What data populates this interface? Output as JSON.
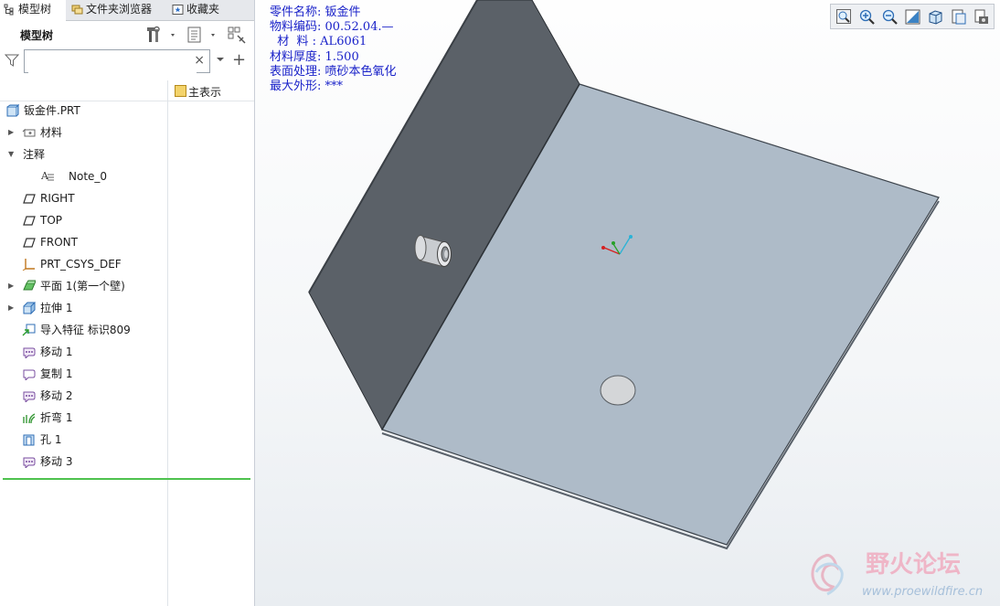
{
  "tabs": [
    {
      "label": "模型树",
      "icon": "tree-icon",
      "active": true
    },
    {
      "label": "文件夹浏览器",
      "icon": "folder-browser-icon",
      "active": false
    },
    {
      "label": "收藏夹",
      "icon": "favorites-icon",
      "active": false
    }
  ],
  "panel": {
    "title": "模型树",
    "search_placeholder": "",
    "search_value": "",
    "clear_glyph": "×",
    "add_glyph": "+",
    "column_header": "主表示"
  },
  "tree": [
    {
      "label": "钣金件.PRT",
      "icon": "part-icon",
      "expandable": false,
      "expanded": false,
      "indent": 0
    },
    {
      "label": "材料",
      "icon": "material-icon",
      "expandable": true,
      "expanded": false,
      "indent": 1
    },
    {
      "label": "注释",
      "icon": "",
      "expandable": true,
      "expanded": true,
      "indent": 1
    },
    {
      "label": "Note_0",
      "icon": "note-icon",
      "expandable": false,
      "expanded": false,
      "indent": 2
    },
    {
      "label": "RIGHT",
      "icon": "datum-plane-icon",
      "expandable": false,
      "expanded": false,
      "indent": 1
    },
    {
      "label": "TOP",
      "icon": "datum-plane-icon",
      "expandable": false,
      "expanded": false,
      "indent": 1
    },
    {
      "label": "FRONT",
      "icon": "datum-plane-icon",
      "expandable": false,
      "expanded": false,
      "indent": 1
    },
    {
      "label": "PRT_CSYS_DEF",
      "icon": "csys-icon",
      "expandable": false,
      "expanded": false,
      "indent": 1
    },
    {
      "label": "平面 1(第一个壁)",
      "icon": "planar-wall-icon",
      "expandable": true,
      "expanded": false,
      "indent": 1
    },
    {
      "label": "拉伸 1",
      "icon": "extrude-icon",
      "expandable": true,
      "expanded": false,
      "indent": 1
    },
    {
      "label": "导入特征 标识809",
      "icon": "import-feature-icon",
      "expandable": false,
      "expanded": false,
      "indent": 1
    },
    {
      "label": "移动 1",
      "icon": "move-icon",
      "expandable": false,
      "expanded": false,
      "indent": 1
    },
    {
      "label": "复制 1",
      "icon": "copy-icon",
      "expandable": false,
      "expanded": false,
      "indent": 1
    },
    {
      "label": "移动 2",
      "icon": "move-icon",
      "expandable": false,
      "expanded": false,
      "indent": 1
    },
    {
      "label": "折弯 1",
      "icon": "bend-icon",
      "expandable": false,
      "expanded": false,
      "indent": 1
    },
    {
      "label": "孔 1",
      "icon": "hole-icon",
      "expandable": false,
      "expanded": false,
      "indent": 1
    },
    {
      "label": "移动 3",
      "icon": "move-icon",
      "expandable": false,
      "expanded": false,
      "indent": 1
    }
  ],
  "annotation": [
    "零件名称: 钣金件",
    "物料编码: 00.52.04.—",
    "  材  料 : AL6061",
    "材料厚度: 1.500",
    "表面处理: 喷砂本色氧化",
    "最大外形: ***"
  ],
  "view_toolbar": [
    "zoom-fit-icon",
    "zoom-in-icon",
    "zoom-out-icon",
    "repaint-icon",
    "display-style-icon",
    "saved-orientations-icon",
    "view-manager-icon"
  ],
  "watermark": {
    "title": "野火论坛",
    "url": "www.proewildfire.cn"
  },
  "colors": {
    "annotation_text": "#1a22c9",
    "wall_face": "#5b6168",
    "base_face": "#aebbc8",
    "tree_end_line": "#4ec24e"
  }
}
